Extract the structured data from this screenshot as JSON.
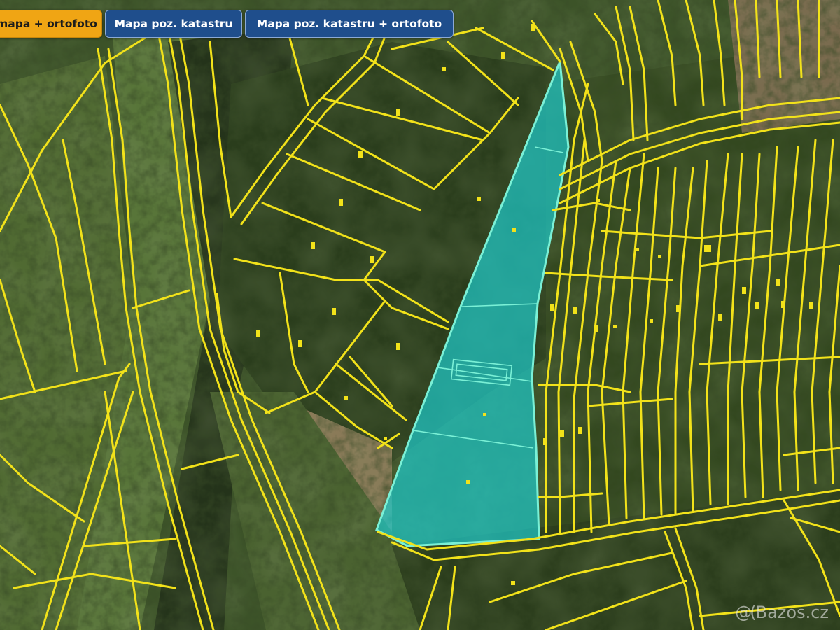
{
  "toolbar": {
    "buttons": [
      {
        "label": "mapa + ortofoto",
        "active": true
      },
      {
        "label": "Mapa poz. katastru",
        "active": false
      },
      {
        "label": "Mapa poz. katastru + ortofoto",
        "active": false
      }
    ]
  },
  "watermark": {
    "icon": "bazos-logo-icon",
    "text": "Bazos.cz"
  },
  "colors": {
    "parcel_line": "#f2e21a",
    "highlight_fill": "#1ec8c8",
    "highlight_line": "#7af0d6",
    "button_active": "#f0a514",
    "button_default": "#1f4e8c"
  }
}
